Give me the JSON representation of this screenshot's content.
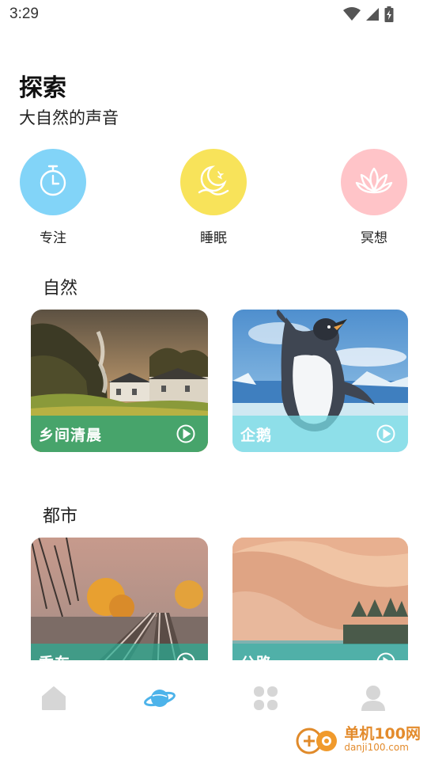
{
  "status_bar": {
    "time": "3:29",
    "icons": [
      "wifi-icon",
      "signal-icon",
      "battery-icon"
    ]
  },
  "header": {
    "title": "探索",
    "subtitle": "大自然的声音"
  },
  "categories": [
    {
      "label": "专注",
      "icon": "timer-icon",
      "color": "#82d4f8"
    },
    {
      "label": "睡眠",
      "icon": "moon-icon",
      "color": "#f8e35a"
    },
    {
      "label": "冥想",
      "icon": "lotus-icon",
      "color": "#ffc4c8"
    }
  ],
  "sections": [
    {
      "title": "自然",
      "cards": [
        {
          "label": "乡间清晨"
        },
        {
          "label": "企鹅"
        }
      ]
    },
    {
      "title": "都市",
      "cards": [
        {
          "label": "乘车"
        },
        {
          "label": "公路"
        }
      ]
    }
  ],
  "bottom_nav": {
    "items": [
      "home-icon",
      "planet-icon",
      "apps-icon",
      "profile-icon"
    ],
    "active_color": "#4db3ea",
    "inactive_color": "#d6d6d6"
  },
  "watermark": {
    "brand": "单机100网",
    "url": "danji100.com"
  }
}
